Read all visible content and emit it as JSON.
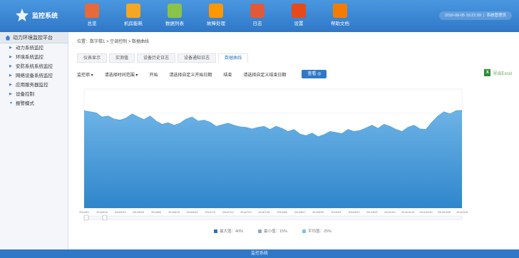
{
  "app": {
    "title": "监控系统",
    "footer": "监控系统"
  },
  "nav": [
    {
      "label": "总览",
      "icon": "books-icon",
      "color": "#e86a3a"
    },
    {
      "label": "机房能耗",
      "icon": "line-chart-icon",
      "color": "#f5a623"
    },
    {
      "label": "数据列表",
      "icon": "data-list-icon",
      "color": "#8bc34a"
    },
    {
      "label": "故障处理",
      "icon": "warning-icon",
      "color": "#ff9800"
    },
    {
      "label": "日志",
      "icon": "calendar-icon",
      "color": "#e05a3a"
    },
    {
      "label": "设置",
      "icon": "settings-icon",
      "color": "#e64a19"
    },
    {
      "label": "帮助文档",
      "icon": "help-icon",
      "color": "#f57c00"
    }
  ],
  "user": {
    "datetime": "2016-08-05 16:21:59",
    "name": "系统管理员"
  },
  "sidebar": {
    "header": "动力环境监控平台",
    "items": [
      {
        "label": "动力系统监控"
      },
      {
        "label": "环境系统监控"
      },
      {
        "label": "安防系统系统监控"
      },
      {
        "label": "网络设备系统监控"
      },
      {
        "label": "应用服务器监控"
      },
      {
        "label": "设备控制"
      },
      {
        "label": "报警模式"
      }
    ]
  },
  "breadcrumb": "位置：数字楼1 > 空调控制 > 数据曲线",
  "tabs": [
    {
      "label": "仪表显示",
      "active": false
    },
    {
      "label": "实测值",
      "active": false
    },
    {
      "label": "设备历史日志",
      "active": false
    },
    {
      "label": "设备通知日志",
      "active": false
    },
    {
      "label": "数据曲线",
      "active": true
    }
  ],
  "filters": {
    "monitor": "监控项 ▾",
    "time_range": "请选择时间范围 ▾",
    "start_label": "开始",
    "start_placeholder": "请选择自定义开始日期",
    "end_label": "结束",
    "end_placeholder": "请选择自定义结束日期",
    "view_button": "查看 ◎",
    "export_label": "导出Excel"
  },
  "chart_data": {
    "type": "area",
    "x": [
      "2014/5/1",
      "2014/5/4",
      "2014/5/7",
      "2014/5/10",
      "2014/5/13",
      "2014/5/16",
      "2014/5/19",
      "2014/5/22",
      "2014/5/25",
      "2014/5/28",
      "2014/5/31",
      "2014/6/3",
      "2014/6/6",
      "2014/6/9",
      "2014/6/12",
      "2014/6/15",
      "2014/6/18",
      "2014/6/21",
      "2014/6/24",
      "2014/6/27",
      "2014/6/30",
      "2014/7/3",
      "2014/7/6",
      "2014/7/9",
      "2014/7/12",
      "2014/7/15",
      "2014/7/18",
      "2014/7/21",
      "2014/7/24",
      "2014/7/27",
      "2014/7/30",
      "2014/8/2",
      "2014/8/5",
      "2014/8/8",
      "2014/8/11",
      "2014/8/14",
      "2014/8/17",
      "2014/8/20",
      "2014/8/23",
      "2014/8/26",
      "2014/8/29",
      "2014/9/1",
      "2014/9/4",
      "2014/9/7",
      "2014/9/10",
      "2014/9/13",
      "2014/9/16",
      "2014/9/19",
      "2014/9/22",
      "2014/9/25",
      "2014/9/28",
      "2014/10/1",
      "2014/10/4",
      "2014/10/7",
      "2014/10/10",
      "2014/10/13",
      "2014/10/16",
      "2014/10/19",
      "2014/10/22",
      "2014/10/25",
      "2014/10/28",
      "2014/10/31",
      "2014/11/3",
      "2014/11/6"
    ],
    "values": [
      188,
      186,
      184,
      176,
      178,
      172,
      170,
      174,
      182,
      176,
      171,
      178,
      168,
      162,
      165,
      160,
      164,
      172,
      176,
      168,
      170,
      166,
      158,
      161,
      164,
      160,
      157,
      156,
      153,
      156,
      158,
      152,
      158,
      154,
      148,
      152,
      143,
      140,
      145,
      138,
      142,
      148,
      146,
      144,
      152,
      148,
      150,
      155,
      160,
      154,
      162,
      158,
      152,
      148,
      156,
      160,
      153,
      152,
      166,
      178,
      186,
      182,
      188,
      189
    ],
    "ylim": [
      0,
      230
    ],
    "x_tick_labels": [
      "2014/5/1",
      "2014/5/10",
      "2014/5/19",
      "2014/5/28",
      "2014/6/6",
      "2014/6/15",
      "2014/6/24",
      "2014/7/3",
      "2014/7/12",
      "2014/7/21",
      "2014/7/30",
      "2014/8/8",
      "2014/8/17",
      "2014/8/26",
      "2014/9/4",
      "2014/9/13",
      "2014/9/22",
      "2014/10/1",
      "2014/10/10",
      "2014/10/19",
      "2014/10/28",
      "2014/11/6"
    ],
    "legend": [
      {
        "label": "最大值：40%",
        "color": "#2f6fb5"
      },
      {
        "label": "最小值：15%",
        "color": "#8fa8c8"
      },
      {
        "label": "平均值：25%",
        "color": "#7cc4e6"
      }
    ],
    "fill_top": "#6db3e6",
    "fill_bottom": "#2f86cc",
    "line_color": "#5aa3dd",
    "grid": true
  },
  "colors": {
    "header": "#2f78c8",
    "accent": "#2f78c8"
  }
}
